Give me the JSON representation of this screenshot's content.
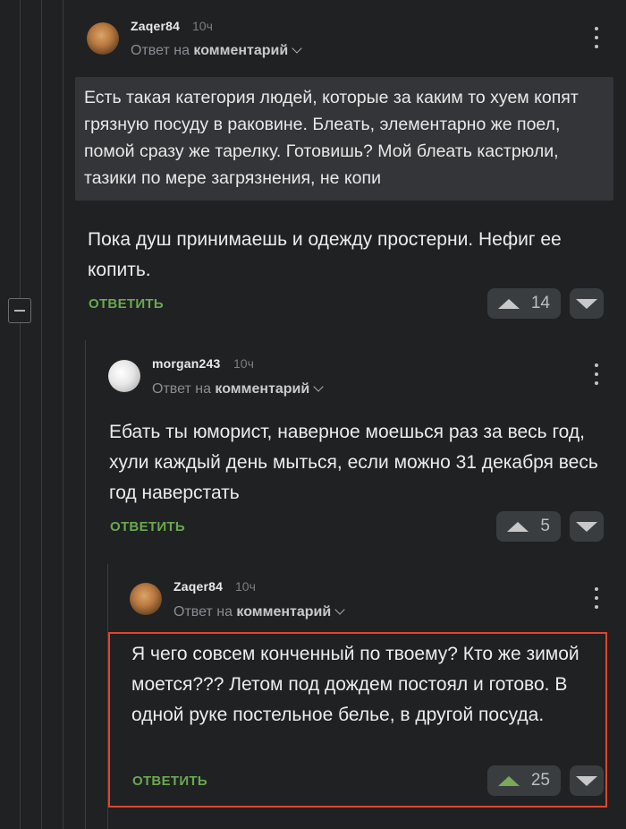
{
  "comments": [
    {
      "username": "Zaqer84",
      "time": "10ч",
      "reply_prefix": "Ответ на",
      "reply_target": "комментарий",
      "quote": "Есть такая категория людей, которые за каким то хуем копят грязную посуду в раковине. Блеать, элементарно же поел, помой сразу же тарелку. Готовишь? Мой блеать кастрюли, тазики по мере загрязнения, не копи",
      "text": "Пока душ принимаешь и одежду простерни. Нефиг ее копить.",
      "reply_label": "ОТВЕТИТЬ",
      "score": "14",
      "avatar": "cat-avatar",
      "upvoted": false
    },
    {
      "username": "morgan243",
      "time": "10ч",
      "reply_prefix": "Ответ на",
      "reply_target": "комментарий",
      "text": "Ебать ты юморист, наверное моешься раз за весь год, хули каждый день мыться, если можно 31 декабря весь год наверстать",
      "reply_label": "ОТВЕТИТЬ",
      "score": "5",
      "avatar": "white-avatar",
      "upvoted": false
    },
    {
      "username": "Zaqer84",
      "time": "10ч",
      "reply_prefix": "Ответ на",
      "reply_target": "комментарий",
      "text": "Я чего совсем конченный по твоему? Кто же зимой моется??? Летом под дождем постоял и готово. В одной руке постельное белье, в другой посуда.",
      "reply_label": "ОТВЕТИТЬ",
      "score": "25",
      "avatar": "cat-avatar",
      "upvoted": true
    }
  ],
  "colors": {
    "background": "#1f2123",
    "accent_green": "#6aa84f",
    "highlight_red": "#e1452d"
  },
  "icons": [
    "collapse-icon",
    "kebab-menu-icon",
    "upvote-icon",
    "downvote-icon",
    "chevron-down-icon"
  ]
}
